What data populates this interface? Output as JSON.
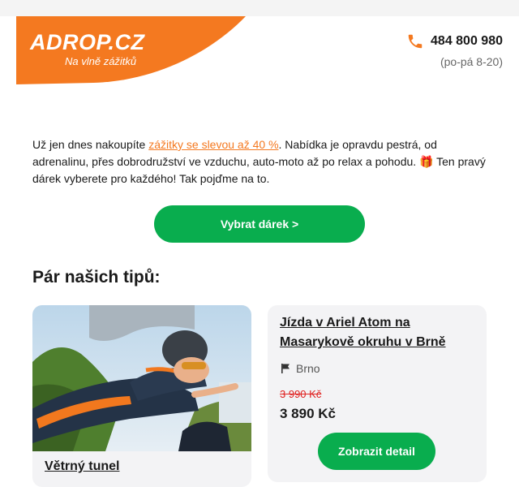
{
  "header": {
    "logo_title": "ADROP.CZ",
    "logo_tagline": "Na vlně zážitků",
    "phone": "484 800 980",
    "phone_hours": "(po-pá 8-20)"
  },
  "intro": {
    "text_before": "Už jen dnes nakoupíte ",
    "link_text": "zážitky se slevou až 40 %",
    "text_after": ". Nabídka je opravdu pestrá, od adrenalinu, přes dobrodružství ve vzduchu, auto-moto až po relax a pohodu. 🎁 Ten pravý dárek vyberete pro každého! Tak pojďme na to."
  },
  "cta": {
    "label": "Vybrat dárek >"
  },
  "tips": {
    "title": "Pár našich tipů:",
    "cards": [
      {
        "title": "Větrný tunel",
        "image_icon": "skydiver-photo"
      },
      {
        "title": "Jízda v Ariel Atom na Masarykově okruhu v Brně",
        "location": "Brno",
        "old_price": "3 990 Kč",
        "new_price": "3 890 Kč",
        "button_label": "Zobrazit detail"
      }
    ]
  },
  "colors": {
    "brand_orange": "#f47920",
    "green": "#09ad4e",
    "sale_red": "#e0201f"
  }
}
